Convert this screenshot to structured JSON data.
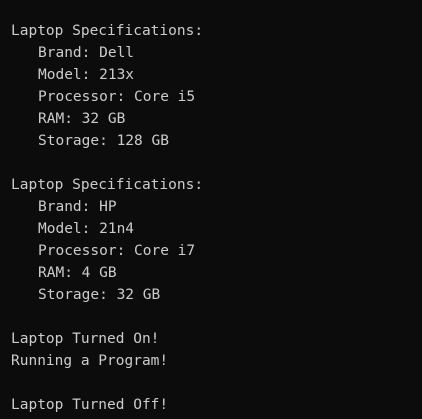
{
  "console": {
    "background": "#0c0c0c",
    "foreground": "#cccccc",
    "laptop1": {
      "header": "Laptop Specifications:",
      "brand": "Brand: Dell",
      "model": "Model: 213x",
      "processor": "Processor: Core i5",
      "ram": "RAM: 32 GB",
      "storage": "Storage: 128 GB"
    },
    "laptop2": {
      "header": "Laptop Specifications:",
      "brand": "Brand: HP",
      "model": "Model: 21n4",
      "processor": "Processor: Core i7",
      "ram": "RAM: 4 GB",
      "storage": "Storage: 32 GB"
    },
    "events": {
      "turned_on": "Laptop Turned On!",
      "running": "Running a Program!",
      "turned_off": "Laptop Turned Off!"
    }
  }
}
